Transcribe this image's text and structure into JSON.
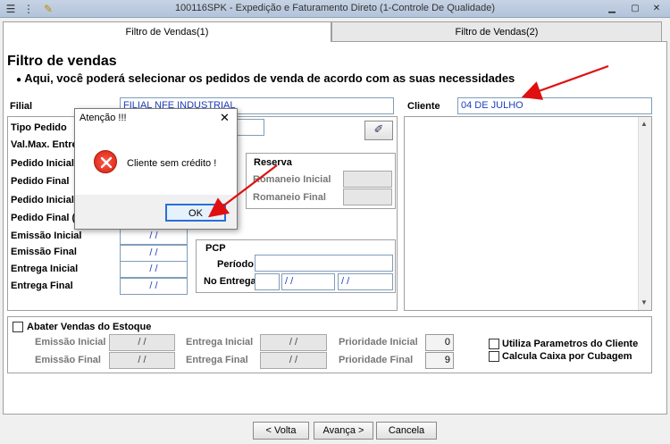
{
  "window": {
    "title": "100116SPK - Expedição e Faturamento Direto (1-Controle De Qualidade)"
  },
  "tabs": [
    {
      "label": "Filtro de Vendas(1)"
    },
    {
      "label": "Filtro de Vendas(2)"
    }
  ],
  "header": {
    "title": "Filtro de vendas",
    "subtitle": "Aqui, você poderá selecionar os pedidos de venda de acordo com as suas necessidades"
  },
  "filial": {
    "label": "Filial",
    "value": "FILIAL NFE INDUSTRIAL"
  },
  "cliente": {
    "label": "Cliente",
    "value": "04 DE JULHO"
  },
  "fields": {
    "tipo_pedido": "Tipo Pedido",
    "val_max": "Val.Max. Entre",
    "pedido_inicial": "Pedido Inicial",
    "pedido_final": "Pedido Final",
    "pedido_inicial2": "Pedido Inicial",
    "pedido_final2": "Pedido Final (C",
    "emissao_inicial": "Emissão Inicial",
    "emissao_final": "Emissão Final",
    "entrega_inicial": "Entrega Inicial",
    "entrega_final": "Entrega Final",
    "date_empty": "/ /"
  },
  "reserva": {
    "title": "Reserva",
    "romaneio_inicial": "Romaneio Inicial",
    "romaneio_final": "Romaneio Final"
  },
  "pcp": {
    "title": "PCP",
    "periodo": "Período",
    "no_entrega": "No Entrega",
    "date1": "/ /",
    "date2": "/ /"
  },
  "abater": {
    "title": "Abater Vendas do Estoque",
    "emissao_inicial": "Emissão Inicial",
    "emissao_final": "Emissão Final",
    "entrega_inicial": "Entrega Inicial",
    "entrega_final": "Entrega Final",
    "prioridade_inicial": "Prioridade Inicial",
    "prioridade_final": "Prioridade Final",
    "prioridade_inicial_value": "0",
    "prioridade_final_value": "9",
    "date_empty": "/ /"
  },
  "options": {
    "utiliza": "Utiliza Parametros do Cliente",
    "calcula": "Calcula Caixa por Cubagem"
  },
  "buttons": {
    "voltar": "< Volta",
    "avanca": "Avança >",
    "cancela": "Cancela"
  },
  "dialog": {
    "title": "Atenção !!!",
    "message": "Cliente sem crédito !",
    "ok": "OK"
  },
  "colors": {
    "annotation_arrow": "#e01010",
    "input_text": "#1f3fbf"
  }
}
